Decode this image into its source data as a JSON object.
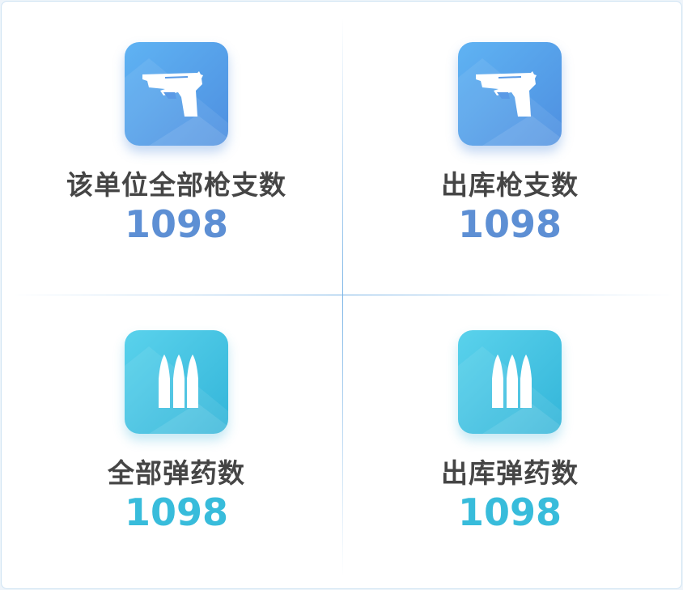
{
  "stats": [
    {
      "label": "该单位全部枪支数",
      "value": "1098",
      "icon": "pistol-icon"
    },
    {
      "label": "出库枪支数",
      "value": "1098",
      "icon": "pistol-icon"
    },
    {
      "label": "全部弹药数",
      "value": "1098",
      "icon": "bullets-icon"
    },
    {
      "label": "出库弹药数",
      "value": "1098",
      "icon": "bullets-icon"
    }
  ],
  "colors": {
    "gun_value": "#5d8fd4",
    "ammo_value": "#38bcdb",
    "label": "#454545"
  }
}
